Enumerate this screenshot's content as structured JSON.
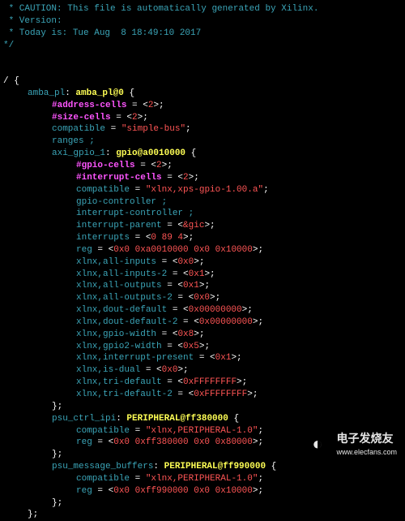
{
  "header": {
    "caution": " * CAUTION: This file is automatically generated by Xilinx.",
    "version": " * Version:",
    "today": " * Today is: Tue Aug  8 18:49:10 2017",
    "close": "*/"
  },
  "root_open": "/ {",
  "amba": {
    "label": "amba_pl",
    "name": "amba_pl@0",
    "open": " {",
    "addr_cells_key": "#address-cells",
    "addr_cells_val": "2",
    "size_cells_key": "#size-cells",
    "size_cells_val": "2",
    "compat_key": "compatible",
    "compat_val": "\"simple-bus\"",
    "ranges": "ranges ;"
  },
  "gpio": {
    "label": "axi_gpio_1",
    "name": "gpio@a0010000",
    "open": " {",
    "gpio_cells_key": "#gpio-cells",
    "gpio_cells_val": "2",
    "int_cells_key": "#interrupt-cells",
    "int_cells_val": "2",
    "compat_key": "compatible",
    "compat_val": "\"xlnx,xps-gpio-1.00.a\"",
    "gpio_ctrl": "gpio-controller ;",
    "int_ctrl": "interrupt-controller ;",
    "int_parent_key": "interrupt-parent",
    "int_parent_val": "&gic",
    "ints_key": "interrupts",
    "ints_val": "0 89 4",
    "reg_key": "reg",
    "reg_val": "0x0 0xa0010000 0x0 0x10000",
    "all_inputs_key": "xlnx,all-inputs",
    "all_inputs_val": "0x0",
    "all_inputs2_key": "xlnx,all-inputs-2",
    "all_inputs2_val": "0x1",
    "all_outputs_key": "xlnx,all-outputs",
    "all_outputs_val": "0x1",
    "all_outputs2_key": "xlnx,all-outputs-2",
    "all_outputs2_val": "0x0",
    "dout_def_key": "xlnx,dout-default",
    "dout_def_val": "0x00000000",
    "dout_def2_key": "xlnx,dout-default-2",
    "dout_def2_val": "0x00000000",
    "gpio_width_key": "xlnx,gpio-width",
    "gpio_width_val": "0x8",
    "gpio2_width_key": "xlnx,gpio2-width",
    "gpio2_width_val": "0x5",
    "int_present_key": "xlnx,interrupt-present",
    "int_present_val": "0x1",
    "is_dual_key": "xlnx,is-dual",
    "is_dual_val": "0x0",
    "tri_def_key": "xlnx,tri-default",
    "tri_def_val": "0xFFFFFFFF",
    "tri_def2_key": "xlnx,tri-default-2",
    "tri_def2_val": "0xFFFFFFFF",
    "close": "};"
  },
  "psu_ctrl": {
    "label": "psu_ctrl_ipi",
    "name": "PERIPHERAL@ff380000",
    "open": " {",
    "compat_key": "compatible",
    "compat_val": "\"xlnx,PERIPHERAL-1.0\"",
    "reg_key": "reg",
    "reg_val": "0x0 0xff380000 0x0 0x80000",
    "close": "};"
  },
  "psu_msg": {
    "label": "psu_message_buffers",
    "name": "PERIPHERAL@ff990000",
    "open": " {",
    "compat_key": "compatible",
    "compat_val": "\"xlnx,PERIPHERAL-1.0\"",
    "reg_key": "reg",
    "reg_val": "0x0 0xff990000 0x0 0x10000",
    "close": "};"
  },
  "amba_close": "};",
  "watermark": {
    "brand": "电子发烧友",
    "url": "www.elecfans.com"
  }
}
